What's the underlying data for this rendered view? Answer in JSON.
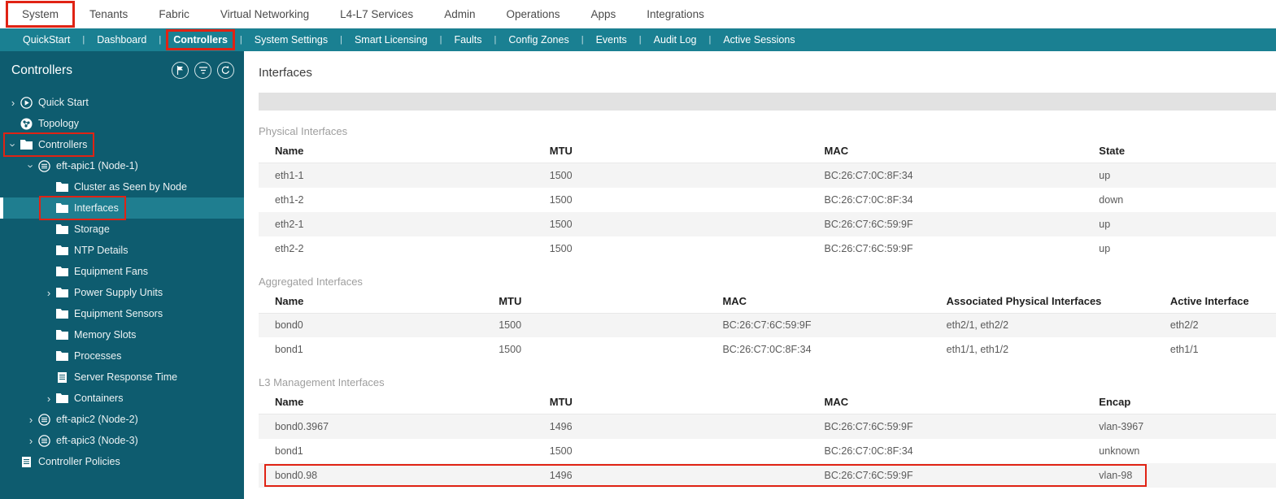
{
  "colors": {
    "annotation_red": "#e02314",
    "subnav_teal": "#1a8092",
    "sidebar_teal": "#0e5c6f",
    "selected_teal": "#1f7e90"
  },
  "topnav": {
    "items": [
      {
        "label": "System",
        "annotated": true
      },
      {
        "label": "Tenants"
      },
      {
        "label": "Fabric"
      },
      {
        "label": "Virtual Networking"
      },
      {
        "label": "L4-L7 Services"
      },
      {
        "label": "Admin"
      },
      {
        "label": "Operations"
      },
      {
        "label": "Apps"
      },
      {
        "label": "Integrations"
      }
    ]
  },
  "subnav": {
    "items": [
      {
        "label": "QuickStart"
      },
      {
        "label": "Dashboard"
      },
      {
        "label": "Controllers",
        "active": true,
        "annotated": true
      },
      {
        "label": "System Settings"
      },
      {
        "label": "Smart Licensing"
      },
      {
        "label": "Faults"
      },
      {
        "label": "Config Zones"
      },
      {
        "label": "Events"
      },
      {
        "label": "Audit Log"
      },
      {
        "label": "Active Sessions"
      }
    ]
  },
  "sidebar": {
    "title": "Controllers",
    "header_icons": [
      "pin",
      "filter",
      "refresh"
    ],
    "tree": [
      {
        "label": "Quick Start",
        "level": 0,
        "icon": "quickstart",
        "expander": "collapsed"
      },
      {
        "label": "Topology",
        "level": 0,
        "icon": "topology",
        "expander": "none"
      },
      {
        "label": "Controllers",
        "level": 0,
        "icon": "folder",
        "expander": "expanded",
        "annotated": true
      },
      {
        "label": "eft-apic1 (Node-1)",
        "level": 1,
        "icon": "node",
        "expander": "expanded"
      },
      {
        "label": "Cluster as Seen by Node",
        "level": 2,
        "icon": "folder",
        "expander": "none"
      },
      {
        "label": "Interfaces",
        "level": 2,
        "icon": "folder",
        "expander": "none",
        "selected": true,
        "annotated": true
      },
      {
        "label": "Storage",
        "level": 2,
        "icon": "folder",
        "expander": "none"
      },
      {
        "label": "NTP Details",
        "level": 2,
        "icon": "folder",
        "expander": "none"
      },
      {
        "label": "Equipment Fans",
        "level": 2,
        "icon": "folder",
        "expander": "none"
      },
      {
        "label": "Power Supply Units",
        "level": 2,
        "icon": "folder",
        "expander": "collapsed"
      },
      {
        "label": "Equipment Sensors",
        "level": 2,
        "icon": "folder",
        "expander": "none"
      },
      {
        "label": "Memory Slots",
        "level": 2,
        "icon": "folder",
        "expander": "none"
      },
      {
        "label": "Processes",
        "level": 2,
        "icon": "folder",
        "expander": "none"
      },
      {
        "label": "Server Response Time",
        "level": 2,
        "icon": "document",
        "expander": "none"
      },
      {
        "label": "Containers",
        "level": 2,
        "icon": "folder",
        "expander": "collapsed"
      },
      {
        "label": "eft-apic2 (Node-2)",
        "level": 1,
        "icon": "node",
        "expander": "collapsed"
      },
      {
        "label": "eft-apic3 (Node-3)",
        "level": 1,
        "icon": "node",
        "expander": "collapsed"
      },
      {
        "label": "Controller Policies",
        "level": 0,
        "icon": "document",
        "expander": "none"
      }
    ]
  },
  "main": {
    "title": "Interfaces",
    "sections": [
      {
        "title": "Physical Interfaces",
        "columns": [
          {
            "label": "Name",
            "width": "27%"
          },
          {
            "label": "MTU",
            "width": "27%"
          },
          {
            "label": "MAC",
            "width": "27%"
          },
          {
            "label": "State",
            "width": "19%"
          }
        ],
        "rows": [
          {
            "cells": [
              "eth1-1",
              "1500",
              "BC:26:C7:0C:8F:34",
              "up"
            ]
          },
          {
            "cells": [
              "eth1-2",
              "1500",
              "BC:26:C7:0C:8F:34",
              "down"
            ]
          },
          {
            "cells": [
              "eth2-1",
              "1500",
              "BC:26:C7:6C:59:9F",
              "up"
            ]
          },
          {
            "cells": [
              "eth2-2",
              "1500",
              "BC:26:C7:6C:59:9F",
              "up"
            ]
          }
        ]
      },
      {
        "title": "Aggregated Interfaces",
        "columns": [
          {
            "label": "Name",
            "width": "22%"
          },
          {
            "label": "MTU",
            "width": "22%"
          },
          {
            "label": "MAC",
            "width": "22%"
          },
          {
            "label": "Associated Physical Interfaces",
            "width": "22%"
          },
          {
            "label": "Active Interface",
            "width": "12%"
          }
        ],
        "rows": [
          {
            "cells": [
              "bond0",
              "1500",
              "BC:26:C7:6C:59:9F",
              "eth2/1, eth2/2",
              "eth2/2"
            ]
          },
          {
            "cells": [
              "bond1",
              "1500",
              "BC:26:C7:0C:8F:34",
              "eth1/1, eth1/2",
              "eth1/1"
            ]
          }
        ]
      },
      {
        "title": "L3 Management Interfaces",
        "columns": [
          {
            "label": "Name",
            "width": "27%"
          },
          {
            "label": "MTU",
            "width": "27%"
          },
          {
            "label": "MAC",
            "width": "27%"
          },
          {
            "label": "Encap",
            "width": "19%"
          }
        ],
        "rows": [
          {
            "cells": [
              "bond0.3967",
              "1496",
              "BC:26:C7:6C:59:9F",
              "vlan-3967"
            ]
          },
          {
            "cells": [
              "bond1",
              "1500",
              "BC:26:C7:0C:8F:34",
              "unknown"
            ]
          },
          {
            "cells": [
              "bond0.98",
              "1496",
              "BC:26:C7:6C:59:9F",
              "vlan-98"
            ],
            "annotated": true
          }
        ]
      }
    ]
  }
}
